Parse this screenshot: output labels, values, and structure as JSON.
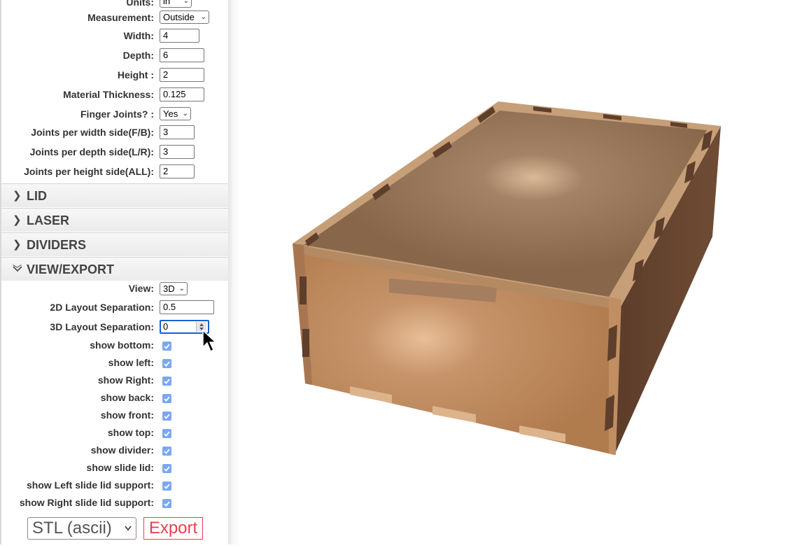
{
  "settings": {
    "units": {
      "label": "Units:",
      "value": "in"
    },
    "measurement": {
      "label": "Measurement:",
      "value": "Outside"
    },
    "width": {
      "label": "Width:",
      "value": "4"
    },
    "depth": {
      "label": "Depth:",
      "value": "6"
    },
    "height": {
      "label": "Height :",
      "value": "2"
    },
    "thickness": {
      "label": "Material Thickness:",
      "value": "0.125"
    },
    "finger_joints": {
      "label": "Finger Joints? :",
      "value": "Yes"
    },
    "joints_width": {
      "label": "Joints per width side(F/B):",
      "value": "3"
    },
    "joints_depth": {
      "label": "Joints per depth side(L/R):",
      "value": "3"
    },
    "joints_height": {
      "label": "Joints per height side(ALL):",
      "value": "2"
    }
  },
  "sections": {
    "lid": "LID",
    "laser": "LASER",
    "dividers": "DIVIDERS",
    "view_export": "VIEW/EXPORT"
  },
  "view_export": {
    "view": {
      "label": "View:",
      "value": "3D"
    },
    "sep2d": {
      "label": "2D Layout Separation:",
      "value": "0.5"
    },
    "sep3d": {
      "label": "3D Layout Separation:",
      "value": "0"
    },
    "checkboxes": [
      {
        "label": "show bottom:",
        "checked": true
      },
      {
        "label": "show left:",
        "checked": true
      },
      {
        "label": "show Right:",
        "checked": true
      },
      {
        "label": "show back:",
        "checked": true
      },
      {
        "label": "show front:",
        "checked": true
      },
      {
        "label": "show top:",
        "checked": true
      },
      {
        "label": "show divider:",
        "checked": true
      },
      {
        "label": "show slide lid:",
        "checked": true
      },
      {
        "label": "show Left slide lid support:",
        "checked": true
      },
      {
        "label": "show Right slide lid support:",
        "checked": true
      }
    ],
    "format": "STL (ascii)",
    "export_label": "Export"
  },
  "colors": {
    "export_red": "#e8414e",
    "checkbox_blue": "#7aa7f3",
    "focus_blue": "#1a5fd6",
    "wood_front": "#b88657",
    "wood_side": "#6e4a34",
    "wood_top": "#8c6a4e"
  },
  "icons": {
    "collapsed": "chevron-right-icon",
    "expanded": "chevron-down-icon",
    "pointer": "cursor-arrow-icon"
  }
}
